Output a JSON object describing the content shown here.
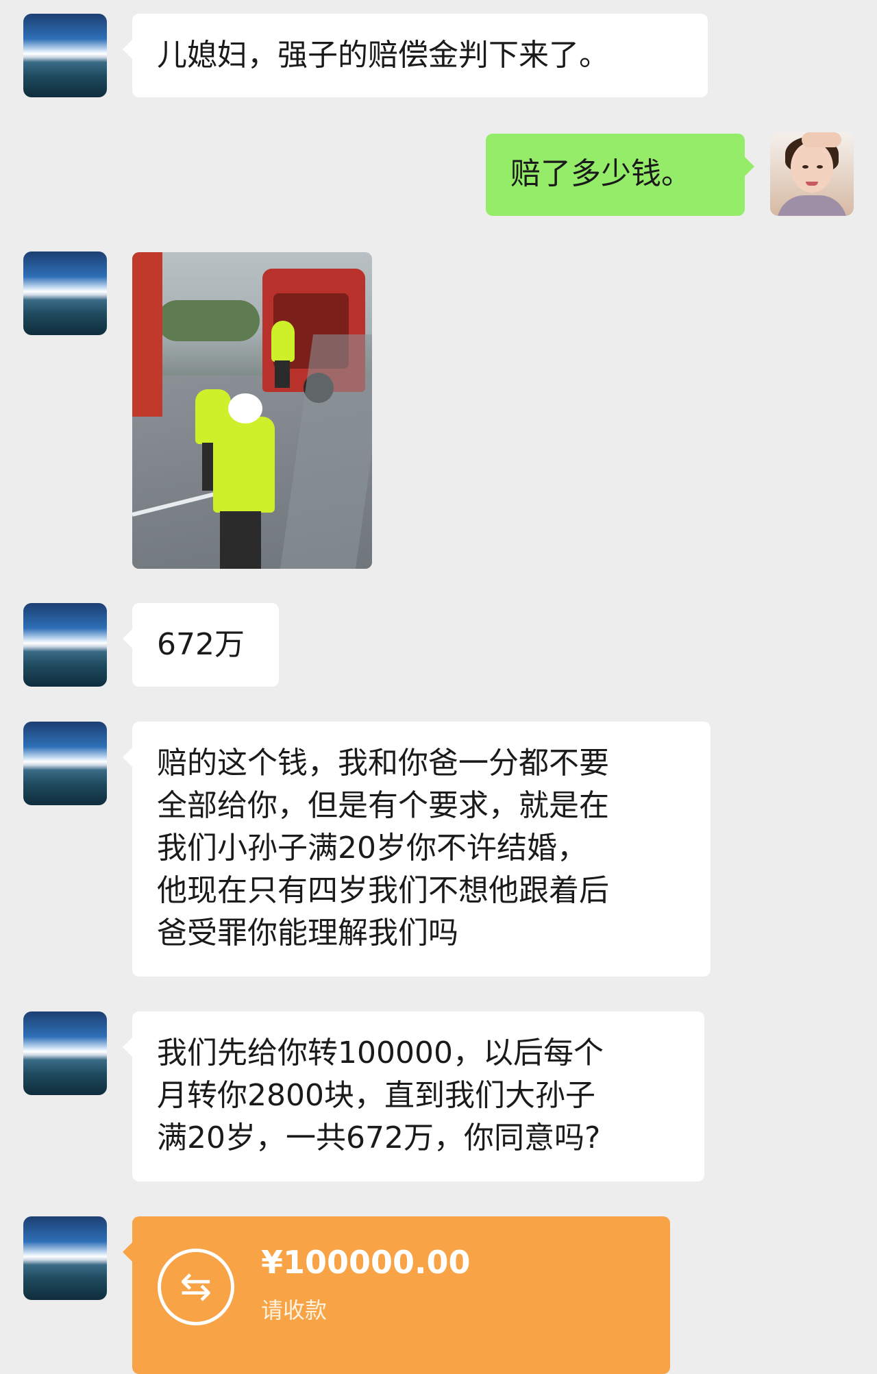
{
  "chat": {
    "messages": [
      {
        "sender": "other",
        "type": "text",
        "lines": [
          "儿媳妇，强子的赔偿金判下来了。"
        ]
      },
      {
        "sender": "self",
        "type": "text",
        "lines": [
          "赔了多少钱。"
        ]
      },
      {
        "sender": "other",
        "type": "image"
      },
      {
        "sender": "other",
        "type": "text",
        "lines": [
          "672万"
        ]
      },
      {
        "sender": "other",
        "type": "text",
        "lines": [
          "赔的这个钱，我和你爸一分都不要",
          "全部给你，但是有个要求，就是在",
          "我们小孙子满20岁你不许结婚，",
          "他现在只有四岁我们不想他跟着后",
          "爸受罪你能理解我们吗"
        ]
      },
      {
        "sender": "other",
        "type": "text",
        "lines": [
          "我们先给你转100000，以后每个",
          "月转你2800块，直到我们大孙子",
          "满20岁，一共672万，你同意吗?"
        ]
      },
      {
        "sender": "other",
        "type": "transfer",
        "amount": "¥100000.00",
        "status": "请收款",
        "icon": "transfer-arrows-icon"
      }
    ]
  },
  "colors": {
    "background": "#ededed",
    "self_bubble": "#95ec69",
    "other_bubble": "#ffffff",
    "transfer_card": "#f7a346"
  }
}
